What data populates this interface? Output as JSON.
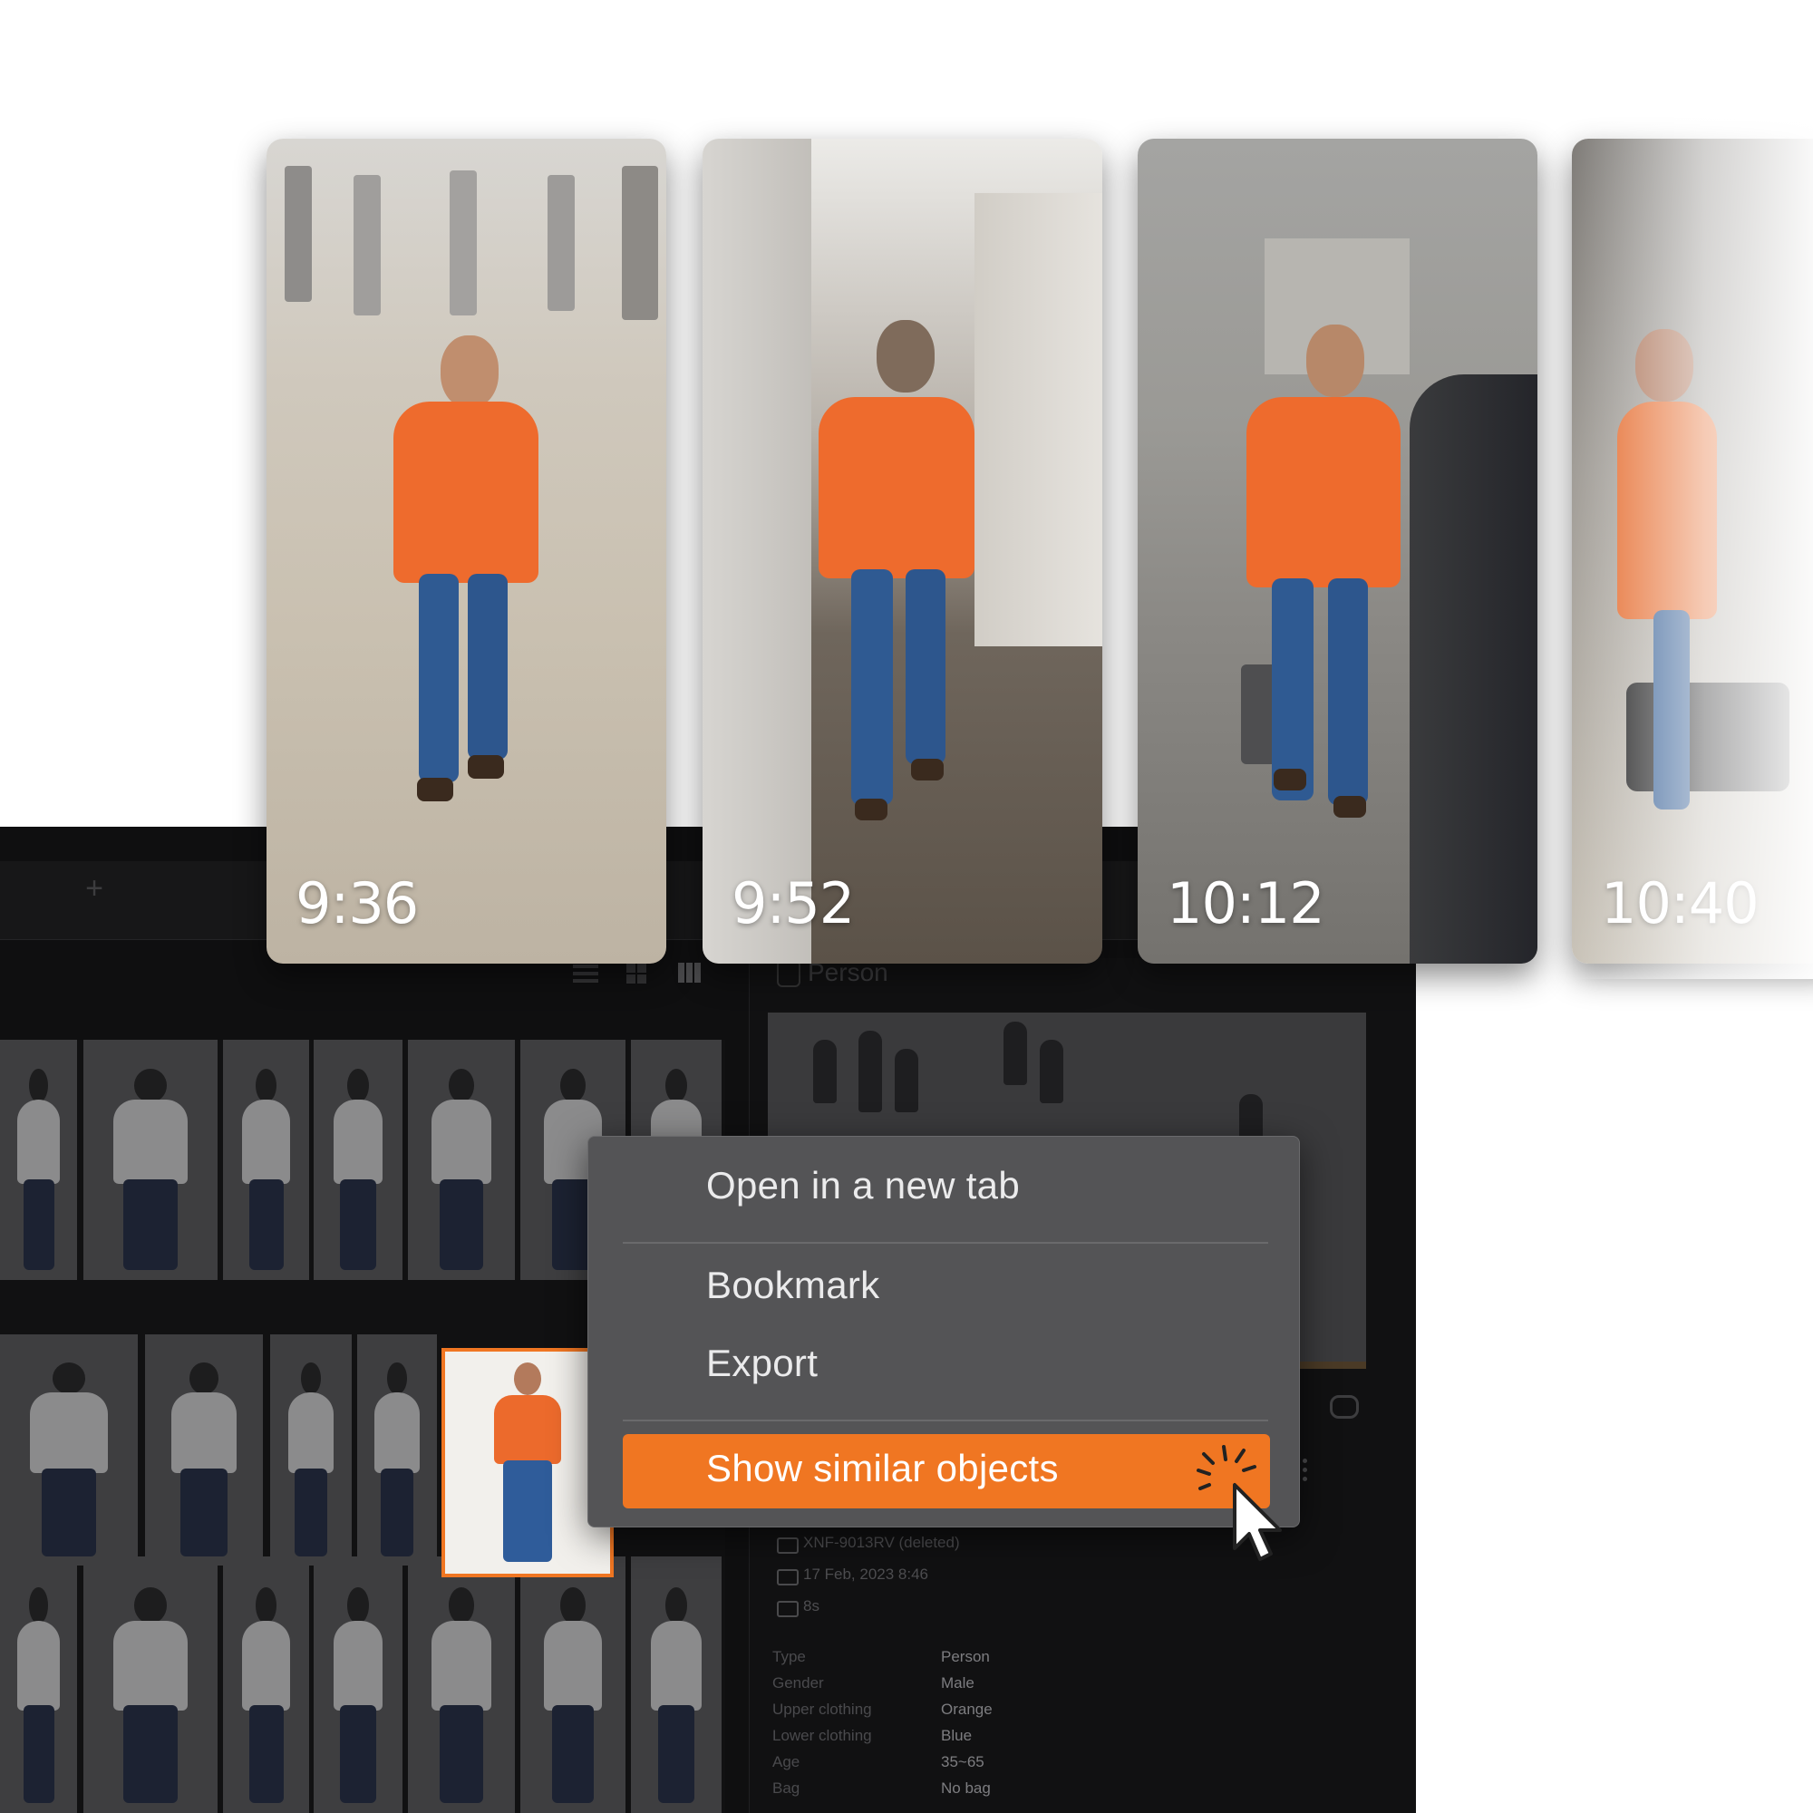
{
  "cards": [
    {
      "time": "9:36"
    },
    {
      "time": "9:52"
    },
    {
      "time": "10:12"
    },
    {
      "time": "10:40"
    }
  ],
  "app": {
    "tab_add_symbol": "+",
    "detail_header": "Person"
  },
  "context_menu": {
    "items": [
      {
        "label": "Open in a new tab"
      },
      {
        "label": "Bookmark"
      },
      {
        "label": "Export"
      },
      {
        "label": "Show similar objects",
        "highlighted": true
      }
    ]
  },
  "details": {
    "camera": "XNF-9013RV (deleted)",
    "datetime": "17 Feb, 2023 8:46",
    "duration": "8s",
    "attributes": [
      {
        "label": "Type",
        "value": "Person"
      },
      {
        "label": "Gender",
        "value": "Male"
      },
      {
        "label": "Upper clothing",
        "value": "Orange"
      },
      {
        "label": "Lower clothing",
        "value": "Blue"
      },
      {
        "label": "Age",
        "value": "35~65"
      },
      {
        "label": "Bag",
        "value": "No bag"
      }
    ]
  },
  "colors": {
    "accent": "#f07622",
    "app_background": "#0f0f10",
    "menu_background": "#545456"
  },
  "icons": [
    "plus-icon",
    "list-view-icon",
    "grid-view-icon",
    "column-view-icon",
    "person-icon",
    "loop-icon",
    "more-vertical-icon",
    "camera-icon",
    "calendar-icon",
    "duration-icon",
    "sparkle-icon",
    "cursor-icon"
  ]
}
